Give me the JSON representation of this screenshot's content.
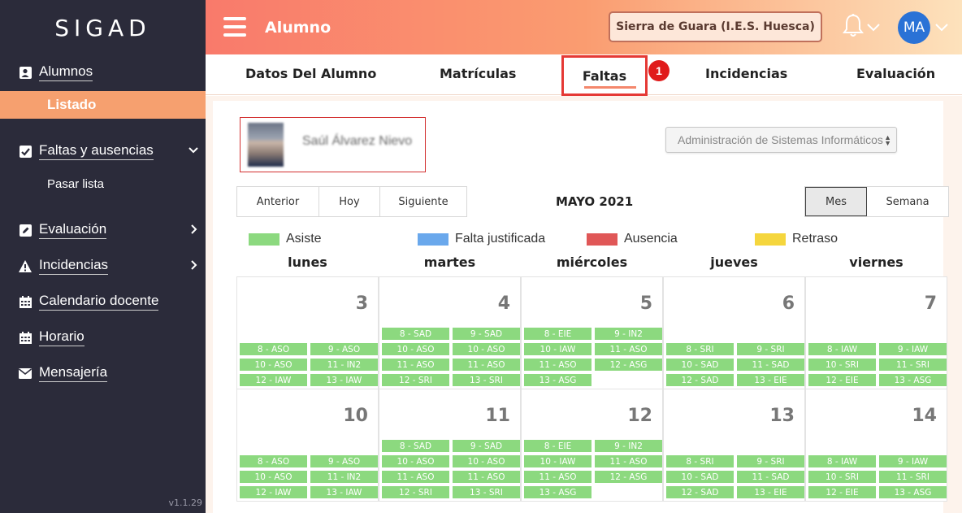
{
  "app": {
    "brand": "SIGAD",
    "version": "v1.1.29"
  },
  "header": {
    "title": "Alumno",
    "center_button": "Sierra de Guara (I.E.S. Huesca)",
    "avatar_initials": "MA"
  },
  "sidebar": {
    "items": [
      {
        "label": "Alumnos",
        "icon": "address-card-icon"
      },
      {
        "label": "Listado",
        "active": true
      },
      {
        "label": "Faltas y ausencias",
        "icon": "check-square-icon"
      },
      {
        "label": "Pasar lista"
      },
      {
        "label": "Evaluación",
        "icon": "edit-icon"
      },
      {
        "label": "Incidencias",
        "icon": "warning-icon"
      },
      {
        "label": "Calendario docente",
        "icon": "calendar-icon"
      },
      {
        "label": "Horario",
        "icon": "calendar-icon"
      },
      {
        "label": "Mensajería",
        "icon": "envelope-icon"
      }
    ]
  },
  "tabs": [
    {
      "label": "Datos Del Alumno"
    },
    {
      "label": "Matrículas"
    },
    {
      "label": "Faltas",
      "active": true
    },
    {
      "label": "Incidencias"
    },
    {
      "label": "Evaluación"
    }
  ],
  "annotation_badge": "1",
  "student": {
    "name": "Saúl Álvarez Nievo"
  },
  "cycle_select": {
    "value": "Administración de Sistemas Informáticos"
  },
  "calendar": {
    "nav": {
      "prev": "Anterior",
      "today": "Hoy",
      "next": "Siguiente"
    },
    "title": "MAYO 2021",
    "views": {
      "month": "Mes",
      "week": "Semana"
    },
    "legend": [
      {
        "label": "Asiste",
        "color": "#8cd97f"
      },
      {
        "label": "Falta justificada",
        "color": "#6aa8ec"
      },
      {
        "label": "Ausencia",
        "color": "#e05757"
      },
      {
        "label": "Retraso",
        "color": "#f5d63d"
      }
    ],
    "weekdays": [
      "lunes",
      "martes",
      "miércoles",
      "jueves",
      "viernes"
    ],
    "weeks": [
      {
        "days": [
          {
            "num": "3",
            "events": [
              "",
              "",
              "8 - ASO",
              "9 - ASO",
              "10 - ASO",
              "11 - IN2",
              "12 - IAW",
              "13 - IAW"
            ]
          },
          {
            "num": "4",
            "events": [
              "8 - SAD",
              "9 - SAD",
              "10 - ASO",
              "10 - ASO",
              "11 - ASO",
              "11 - ASO",
              "12 - SRI",
              "13 - SRI"
            ]
          },
          {
            "num": "5",
            "events": [
              "8 - EIE",
              "9 - IN2",
              "10 - IAW",
              "11 - ASO",
              "11 - ASO",
              "12 - ASG",
              "13 - ASG",
              ""
            ]
          },
          {
            "num": "6",
            "events": [
              "",
              "",
              "8 - SRI",
              "9 - SRI",
              "10 - SAD",
              "11 - SAD",
              "12 - SAD",
              "13 - EIE"
            ]
          },
          {
            "num": "7",
            "events": [
              "",
              "",
              "8 - IAW",
              "9 - IAW",
              "10 - SRI",
              "11 - SRI",
              "12 - EIE",
              "13 - ASG"
            ]
          }
        ]
      },
      {
        "days": [
          {
            "num": "10",
            "events": [
              "",
              "",
              "8 - ASO",
              "9 - ASO",
              "10 - ASO",
              "11 - IN2",
              "12 - IAW",
              "13 - IAW"
            ]
          },
          {
            "num": "11",
            "events": [
              "8 - SAD",
              "9 - SAD",
              "10 - ASO",
              "10 - ASO",
              "11 - ASO",
              "11 - ASO",
              "12 - SRI",
              "13 - SRI"
            ]
          },
          {
            "num": "12",
            "events": [
              "8 - EIE",
              "9 - IN2",
              "10 - IAW",
              "11 - ASO",
              "11 - ASO",
              "12 - ASG",
              "13 - ASG",
              ""
            ]
          },
          {
            "num": "13",
            "events": [
              "",
              "",
              "8 - SRI",
              "9 - SRI",
              "10 - SAD",
              "11 - SAD",
              "12 - SAD",
              "13 - EIE"
            ]
          },
          {
            "num": "14",
            "events": [
              "",
              "",
              "8 - IAW",
              "9 - IAW",
              "10 - SRI",
              "11 - SRI",
              "12 - EIE",
              "13 - ASG"
            ]
          }
        ]
      }
    ]
  }
}
